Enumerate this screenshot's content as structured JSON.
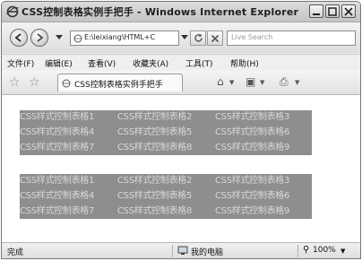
{
  "window": {
    "title": "CSS控制表格实例手把手 - Windows Internet Explorer"
  },
  "address_bar": {
    "url": "E:\\leixiang\\HTML+C",
    "search_placeholder": "Live Search"
  },
  "menu": {
    "items": [
      "文件(F)",
      "编辑(E)",
      "查看(V)",
      "收藏夹(A)",
      "工具(T)",
      "帮助(H)"
    ]
  },
  "tab": {
    "label": "CSS控制表格实例手把手"
  },
  "table1": {
    "rows": [
      [
        "CSS样式控制表格1",
        "CSS样式控制表格2",
        "CSS样式控制表格3"
      ],
      [
        "CSS样式控制表格4",
        "CSS样式控制表格5",
        "CSS样式控制表格6"
      ],
      [
        "CSS样式控制表格7",
        "CSS样式控制表格8",
        "CSS样式控制表格9"
      ]
    ]
  },
  "table2": {
    "rows": [
      [
        "CSS样式控制表格1",
        "CSS样式控制表格2",
        "CSS样式控制表格3"
      ],
      [
        "CSS样式控制表格4",
        "CSS样式控制表格5",
        "CSS样式控制表格6"
      ],
      [
        "CSS样式控制表格7",
        "CSS样式控制表格8",
        "CSS样式控制表格9"
      ]
    ]
  },
  "status": {
    "text": "完成",
    "zone": "我的电脑",
    "zoom": "100%"
  }
}
